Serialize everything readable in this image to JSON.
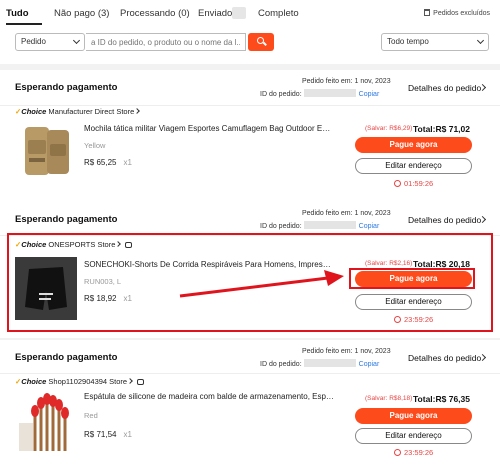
{
  "tabs": [
    {
      "label": "Tudo",
      "active": true
    },
    {
      "label": "Não pago (3)",
      "active": false
    },
    {
      "label": "Processando (0)",
      "active": false
    },
    {
      "label": "Enviado",
      "active": false
    },
    {
      "label": "Completo",
      "active": false
    }
  ],
  "excluded_orders_label": "Pedidos excluídos",
  "filters": {
    "field_select": "Pedido",
    "search_placeholder": "a ID do pedido, o produto ou o nome da l...",
    "date_select": "Todo tempo"
  },
  "orders": [
    {
      "status": "Esperando pagamento",
      "date": "Pedido feito em: 1 nov, 2023",
      "id_label": "ID do pedido:",
      "copy": "Copiar",
      "details": "Detalhes do pedido",
      "choice": "Choice",
      "store": "Manufacturer Direct Store",
      "title": "Mochila tática militar Viagem Esportes Camuflagem Bag Outdoor Escal...",
      "variant": "Yellow",
      "price": "R$ 65,25",
      "qty": "x1",
      "saved": "(Salvar: R$6,29)",
      "total": "Total:R$ 71,02",
      "pay": "Pague agora",
      "edit": "Editar endereço",
      "timer": "01:59:26"
    },
    {
      "status": "Esperando pagamento",
      "date": "Pedido feito em: 1 nov, 2023",
      "id_label": "ID do pedido:",
      "copy": "Copiar",
      "details": "Detalhes do pedido",
      "choice": "Choice",
      "store": "ONESPORTS Store",
      "title": "SONECHOKI-Shorts De Corrida Respiráveis Para Homens, Impressão Li...",
      "variant": "RUN003, L",
      "price": "R$ 18,92",
      "qty": "x1",
      "saved": "(Salvar: R$2,16)",
      "total": "Total:R$ 20,18",
      "pay": "Pague agora",
      "edit": "Editar endereço",
      "timer": "23:59:26"
    },
    {
      "status": "Esperando pagamento",
      "date": "Pedido feito em: 1 nov, 2023",
      "id_label": "ID do pedido:",
      "copy": "Copiar",
      "details": "Detalhes do pedido",
      "choice": "Choice",
      "store": "Shop1102904394 Store",
      "title": "Espátula de silicone de madeira com balde de armazenamento, Espátul...",
      "variant": "Red",
      "price": "R$ 71,54",
      "qty": "x1",
      "saved": "(Salvar: R$8,18)",
      "total": "Total:R$ 76,35",
      "pay": "Pague agora",
      "edit": "Editar endereço",
      "timer": "23:59:26"
    }
  ],
  "colors": {
    "accent": "#fd4b1c",
    "highlight": "#e0141c",
    "link": "#2f7be0",
    "warning": "#e64545"
  }
}
